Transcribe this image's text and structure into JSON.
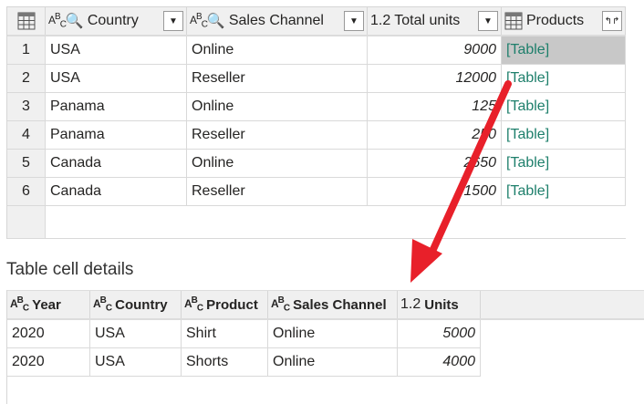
{
  "main_table": {
    "columns": [
      {
        "type": "ABC",
        "key": true,
        "label": "Country"
      },
      {
        "type": "ABC",
        "key": true,
        "label": "Sales Channel"
      },
      {
        "type": "1.2",
        "label": "Total units"
      },
      {
        "type": "table",
        "label": "Products"
      }
    ],
    "rows": [
      {
        "n": "1",
        "country": "USA",
        "channel": "Online",
        "units": "9000",
        "products": "[Table]"
      },
      {
        "n": "2",
        "country": "USA",
        "channel": "Reseller",
        "units": "12000",
        "products": "[Table]"
      },
      {
        "n": "3",
        "country": "Panama",
        "channel": "Online",
        "units": "125",
        "products": "[Table]"
      },
      {
        "n": "4",
        "country": "Panama",
        "channel": "Reseller",
        "units": "250",
        "products": "[Table]"
      },
      {
        "n": "5",
        "country": "Canada",
        "channel": "Online",
        "units": "2650",
        "products": "[Table]"
      },
      {
        "n": "6",
        "country": "Canada",
        "channel": "Reseller",
        "units": "1500",
        "products": "[Table]"
      }
    ]
  },
  "details": {
    "title": "Table cell details",
    "columns": [
      {
        "type": "ABC",
        "label": "Year"
      },
      {
        "type": "ABC",
        "label": "Country"
      },
      {
        "type": "ABC",
        "label": "Product"
      },
      {
        "type": "ABC",
        "label": "Sales Channel"
      },
      {
        "type": "1.2",
        "label": "Units"
      }
    ],
    "rows": [
      {
        "year": "2020",
        "country": "USA",
        "product": "Shirt",
        "channel": "Online",
        "units": "5000"
      },
      {
        "year": "2020",
        "country": "USA",
        "product": "Shorts",
        "channel": "Online",
        "units": "4000"
      }
    ]
  },
  "annotation_color": "#e8202a"
}
